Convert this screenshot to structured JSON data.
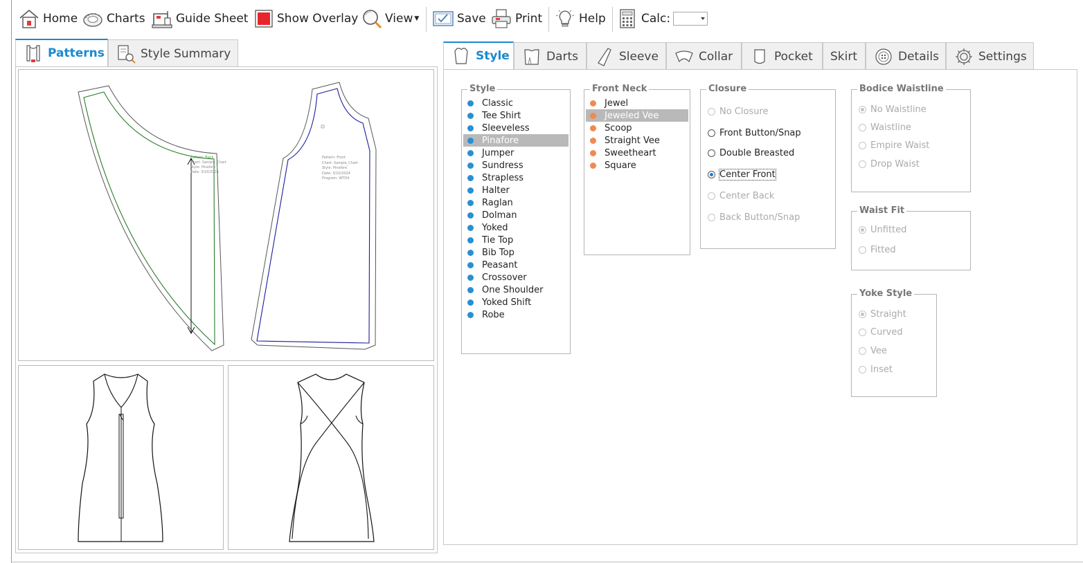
{
  "toolbar": {
    "home": "Home",
    "charts": "Charts",
    "guide_sheet": "Guide Sheet",
    "show_overlay": "Show Overlay",
    "view": "View",
    "save": "Save",
    "print": "Print",
    "help": "Help",
    "calc": "Calc:",
    "calc_value": ""
  },
  "left_tabs": [
    {
      "label": "Patterns",
      "active": true
    },
    {
      "label": "Style Summary",
      "active": false
    }
  ],
  "right_tabs": [
    {
      "label": "Style",
      "active": true
    },
    {
      "label": "Darts"
    },
    {
      "label": "Sleeve"
    },
    {
      "label": "Collar"
    },
    {
      "label": "Pocket"
    },
    {
      "label": "Skirt"
    },
    {
      "label": "Details"
    },
    {
      "label": "Settings"
    }
  ],
  "pattern_back": {
    "lines": [
      "Pattern: Back",
      "Chart: Sample_Chart",
      "Style: Pinafore",
      "Date: 3/10/2024"
    ]
  },
  "pattern_front": {
    "lines": [
      "Pattern: Front",
      "Chart: Sample_Chart",
      "Style: Pinafore",
      "Date: 3/10/2024",
      "Program: WTD4"
    ]
  },
  "style_group": {
    "title": "Style",
    "dot_color": "#2a8fd0",
    "selected": "Pinafore",
    "items": [
      "Classic",
      "Tee Shirt",
      "Sleeveless",
      "Pinafore",
      "Jumper",
      "Sundress",
      "Strapless",
      "Halter",
      "Raglan",
      "Dolman",
      "Yoked",
      "Tie Top",
      "Bib Top",
      "Peasant",
      "Crossover",
      "One Shoulder",
      "Yoked Shift",
      "Robe"
    ]
  },
  "front_neck_group": {
    "title": "Front Neck",
    "dot_color": "#f08a50",
    "selected": "Jeweled Vee",
    "items": [
      "Jewel",
      "Jeweled Vee",
      "Scoop",
      "Straight Vee",
      "Sweetheart",
      "Square"
    ]
  },
  "closure_group": {
    "title": "Closure",
    "options": [
      {
        "label": "No Closure",
        "enabled": false,
        "checked": false
      },
      {
        "label": "Front Button/Snap",
        "enabled": true,
        "checked": false
      },
      {
        "label": "Double Breasted",
        "enabled": true,
        "checked": false
      },
      {
        "label": "Center Front",
        "enabled": true,
        "checked": true
      },
      {
        "label": "Center Back",
        "enabled": false,
        "checked": false
      },
      {
        "label": "Back Button/Snap",
        "enabled": false,
        "checked": false
      }
    ]
  },
  "bodice_waistline_group": {
    "title": "Bodice Waistline",
    "options": [
      {
        "label": "No Waistline",
        "checked": true
      },
      {
        "label": "Waistline",
        "checked": false
      },
      {
        "label": "Empire Waist",
        "checked": false
      },
      {
        "label": "Drop Waist",
        "checked": false
      }
    ]
  },
  "waist_fit_group": {
    "title": "Waist Fit",
    "options": [
      {
        "label": "Unfitted",
        "checked": true
      },
      {
        "label": "Fitted",
        "checked": false
      }
    ]
  },
  "yoke_style_group": {
    "title": "Yoke Style",
    "options": [
      {
        "label": "Straight",
        "checked": true
      },
      {
        "label": "Curved",
        "checked": false
      },
      {
        "label": "Vee",
        "checked": false
      },
      {
        "label": "Inset",
        "checked": false
      }
    ]
  }
}
